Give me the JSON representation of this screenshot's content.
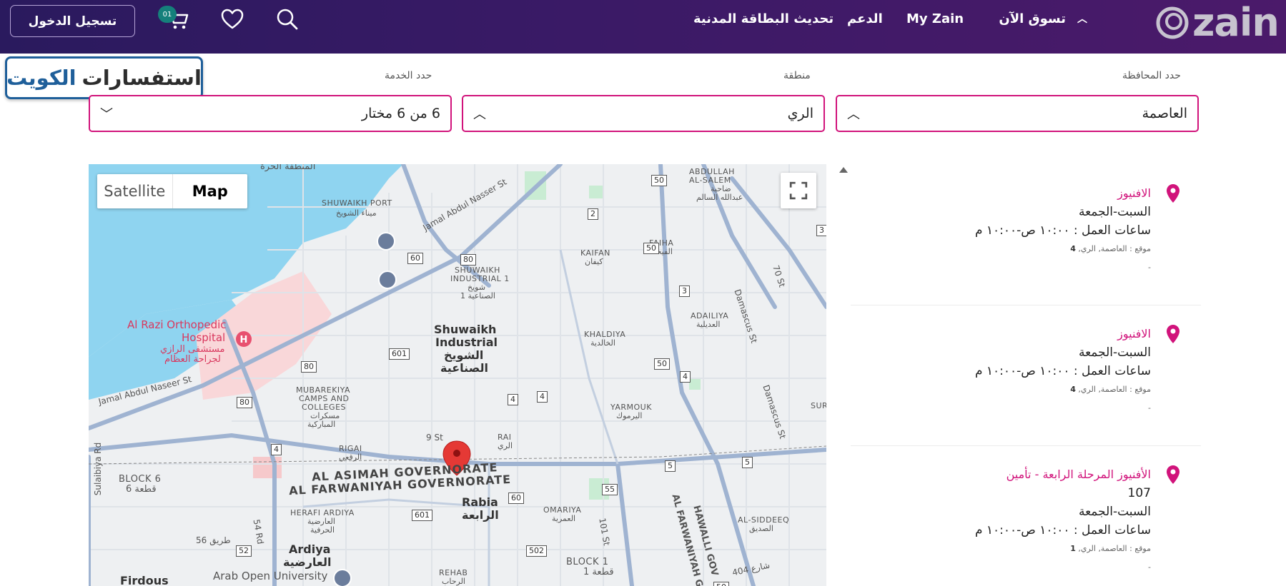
{
  "header": {
    "logo_text": "zain",
    "nav": {
      "shop": "تسوق الآن",
      "my_zain": "My Zain",
      "support": "الدعم",
      "civil_card": "تحديث البطاقة المدنية"
    },
    "cart_count": "01",
    "login_label": "تسجيل الدخول"
  },
  "country_badge": {
    "prefix": "استفسارات",
    "country": "الكويت"
  },
  "filters": {
    "governorate": {
      "label": "حدد المحافظة",
      "value": "العاصمة"
    },
    "area": {
      "label": "منطقة",
      "value": "الري"
    },
    "service": {
      "label": "حدد الخدمة",
      "value": "6 من 6 مختار"
    }
  },
  "map": {
    "tabs": {
      "map": "Map",
      "satellite": "Satellite"
    },
    "labels": {
      "shuwaikh_industrial": "Shuwaikh",
      "shuwaikh_industrial2": "Industrial",
      "shuwaikh_ar": "الشويخ",
      "shuwaikh_ar2": "الصناعية",
      "rabia": "Rabia",
      "rabia_ar": "الرابعة",
      "ardiya": "Ardiya",
      "ardiya_ar": "العارضية",
      "firdous": "Firdous",
      "hospital1": "Al Razi Orthopedic",
      "hospital2": "Hospital",
      "hospital_ar1": "مستشفى الرازي",
      "hospital_ar2": "لجراحة العظام",
      "gov1": "AL ASIMAH GOVERNORATE",
      "gov2": "AL FARWANIYAH GOVERNORATE",
      "shuwaikh_port": "SHUWAIKH PORT",
      "shuwaikh_port_ar": "ميناء الشويخ",
      "shuwaikh_ind1": "SHUWAIKH",
      "shuwaikh_ind1b": "INDUSTRIAL 1",
      "shuwaikh_ind1_ar": "شويخ",
      "shuwaikh_ind1_ar2": "الصناعية 1",
      "kaifan": "KAIFAN",
      "kaifan_ar": "كيفان",
      "faiha": "FAIHA",
      "faiha_ar": "الفيحاء",
      "khaldiya": "KHALDIYA",
      "khaldiya_ar": "الخالدية",
      "adailiya": "ADAILIYA",
      "adailiya_ar": "العديلية",
      "yarmouk": "YARMOUK",
      "yarmouk_ar": "اليرموك",
      "mubarekiya1": "MUBAREKIYA",
      "mubarekiya2": "CAMPS AND",
      "mubarekiya3": "COLLEGES",
      "mubarekiya_ar1": "مسكرات",
      "mubarekiya_ar2": "المباركية",
      "rigai": "RIGAI",
      "rigai_ar": "الرقعي",
      "rai": "RAI",
      "rai_ar": "الري",
      "omariya": "OMARIYA",
      "omariya_ar": "العمرية",
      "herafi1": "HERAFI ARDIYA",
      "herafi_ar1": "العارضية",
      "herafi_ar2": "الحرفية",
      "block6": "BLOCK 6",
      "block6_ar": "قطعة 6",
      "block1": "BLOCK 1",
      "block1_ar": "قطعة 1",
      "rehab": "REHAB",
      "rehab_ar": "الرحاب",
      "alsiddeeq": "AL-SIDDEEQ",
      "alsiddeeq_ar": "الصديق",
      "abdullah1": "ABDULLAH",
      "abdullah2": "AL-SALEM",
      "abdullah_ar1": "ضاحية",
      "abdullah_ar2": "عبدالله السالم",
      "mantiqa": "المنطقة الحرة",
      "sulaibiya": "Sulaibiya Rd",
      "jamal1": "Jamal Abdul Nasser St",
      "jamal2": "Jamal Abdul Naseer St",
      "damascus1": "Damascus St",
      "damascus2": "Damascus St",
      "st70": "70 St",
      "st9": "9 St",
      "st101": "101 St",
      "rd54": "54 Rd",
      "tariq56": "طريق 56",
      "st404": "شارع 404",
      "hawalli": "HAWALLI GOV",
      "farwaniyah_v": "AL FARWANIYAH G",
      "arab_open": "Arab Open University",
      "sur": "SUR",
      "rabia_dup": "",
      "road50a": "50",
      "road50b": "50",
      "road50c": "50",
      "road2": "2",
      "road3": "3",
      "road3b": "3",
      "road4a": "4",
      "road4b": "4",
      "road4c": "4",
      "road4d": "4",
      "road5a": "5",
      "road5b": "5",
      "road55": "55",
      "road60a": "60",
      "road60b": "60",
      "road80a": "80",
      "road80b": "80",
      "road80c": "80",
      "road601a": "601",
      "road601b": "601",
      "road502": "502",
      "road52": "52",
      "road50d": "50"
    }
  },
  "results": [
    {
      "name": "الافنيوز",
      "extra": "",
      "days": "السبت-الجمعة",
      "hours": "ساعات العمل : ١٠:٠٠ ص-١٠:٠٠ م",
      "loc_label": "موقع :",
      "loc_text": "العاصمة, الري,",
      "loc_num": "4",
      "dash": "-"
    },
    {
      "name": "الافنيوز",
      "extra": "",
      "days": "السبت-الجمعة",
      "hours": "ساعات العمل : ١٠:٠٠ ص-١٠:٠٠ م",
      "loc_label": "موقع :",
      "loc_text": "العاصمة, الري,",
      "loc_num": "4",
      "dash": "-"
    },
    {
      "name": "الأفنيوز المرحلة الرابعة - تأمين",
      "extra": "107",
      "days": "السبت-الجمعة",
      "hours": "ساعات العمل : ١٠:٠٠ ص-١٠:٠٠ م",
      "loc_label": "موقع :",
      "loc_text": "العاصمة, الري,",
      "loc_num": "1",
      "dash": "-"
    }
  ],
  "colors": {
    "accent": "#d1137b",
    "header_start": "#2a1a5e",
    "header_end": "#4b1a6a",
    "badge": "#15807b",
    "water": "#8fd4f0",
    "country_blue": "#1f5f9a"
  }
}
